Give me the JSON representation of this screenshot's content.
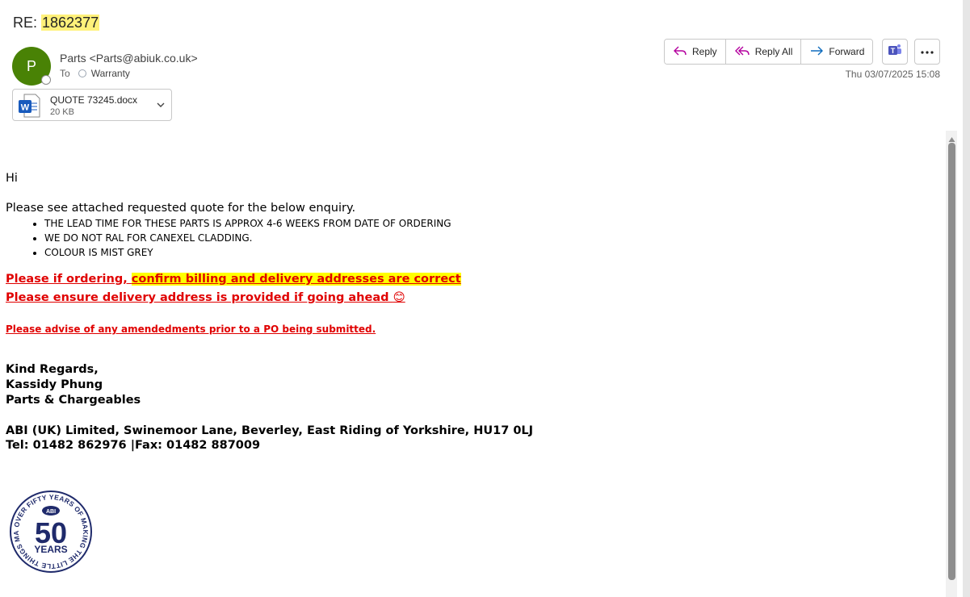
{
  "email": {
    "subject_prefix": "RE: ",
    "subject_number": "1862377",
    "sender_initial": "P",
    "sender": "Parts <Parts@abiuk.co.uk>",
    "to_label": "To",
    "recipient": "Warranty",
    "date": "Thu 03/07/2025 15:08"
  },
  "attachment": {
    "name": "QUOTE 73245.docx",
    "size": "20 KB"
  },
  "toolbar": {
    "reply": "Reply",
    "reply_all": "Reply All",
    "forward": "Forward"
  },
  "body": {
    "greeting": "Hi",
    "intro": "Please see attached requested quote for the below enquiry.",
    "bullets": [
      "THE LEAD TIME FOR THESE PARTS IS APPROX 4-6 WEEKS FROM DATE OF ORDERING",
      "WE DO NOT RAL FOR CANEXEL CLADDING.",
      "COLOUR IS MIST GREY"
    ],
    "note1_a": "Please if ordering, ",
    "note1_b": "confirm billing and delivery addresses are correct",
    "note2": "Please ensure delivery address is provided if going ahead ",
    "note2_emoji": "😊",
    "note3": "Please advise of any amendedments prior to a PO being submitted.",
    "sig_line1": "Kind Regards,",
    "sig_line2": "Kassidy Phung",
    "sig_line3": "Parts & Chargeables",
    "address": "ABI (UK) Limited, Swinemoor Lane, Beverley, East Riding of Yorkshire, HU17 0LJ",
    "phone": "Tel: 01482 862976 |Fax: 01482 887009"
  },
  "logo": {
    "ring_text": "OVER FIFTY YEARS OF MAKING THE LITTLE THINGS MATTER",
    "brand": "ABI",
    "number": "50",
    "years": "YEARS"
  },
  "colors": {
    "avatar": "#498205",
    "accent_red": "#e00000",
    "highlight": "#ffff00",
    "subject_highlight": "#fff17a",
    "logo_navy": "#1f2a6b"
  }
}
